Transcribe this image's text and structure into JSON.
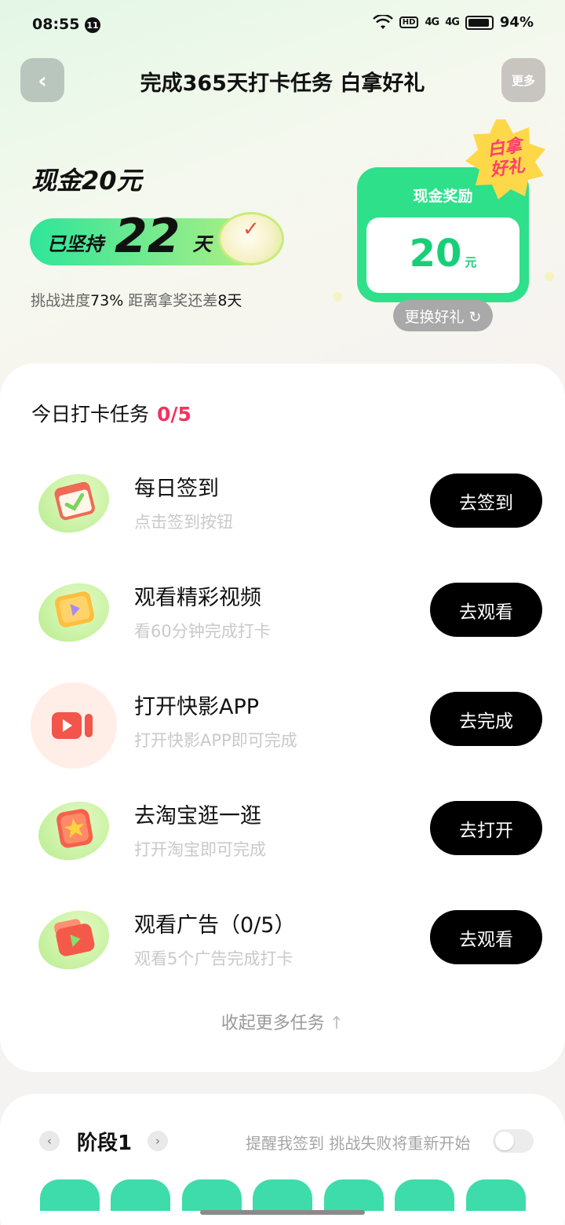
{
  "status_bar": {
    "time": "08:55",
    "notification_count": "11",
    "hd_label": "HD",
    "signal1": "4G",
    "signal2": "4G",
    "battery_percent": "94%",
    "battery_level": 0.94
  },
  "nav": {
    "back_icon": "‹",
    "title": "完成365天打卡任务 白拿好礼",
    "more_label": "更多"
  },
  "hero": {
    "cash_title": "现金20元",
    "streak_prefix": "已坚持",
    "streak_days": "22",
    "streak_suffix": "天",
    "progress_prefix": "挑战进度",
    "progress_percent": "73%",
    "progress_middle": "距离拿奖还差",
    "days_remaining": "8天"
  },
  "reward": {
    "label": "现金奖励",
    "amount": "20",
    "unit": "元",
    "badge_line1": "白拿",
    "badge_line2": "好礼",
    "swap_label": "更换好礼 ↻"
  },
  "tasks": {
    "header": "今日打卡任务",
    "count": "0/5",
    "items": [
      {
        "title": "每日签到",
        "subtitle": "点击签到按钮",
        "button": "去签到",
        "icon": "calendar-check-icon"
      },
      {
        "title": "观看精彩视频",
        "subtitle": "看60分钟完成打卡",
        "button": "去观看",
        "icon": "video-tablet-icon"
      },
      {
        "title": "打开快影APP",
        "subtitle": "打开快影APP即可完成",
        "button": "去完成",
        "icon": "video-camera-icon"
      },
      {
        "title": "去淘宝逛一逛",
        "subtitle": "打开淘宝即可完成",
        "button": "去打开",
        "icon": "star-shop-icon"
      },
      {
        "title": "观看广告（0/5）",
        "subtitle": "观看5个广告完成打卡",
        "button": "去观看",
        "icon": "ad-play-icon"
      }
    ],
    "collapse_label": "收起更多任务",
    "collapse_arrow": "↑"
  },
  "stage": {
    "prev_icon": "‹",
    "title": "阶段1",
    "next_icon": "›",
    "reminder": "提醒我签到 挑战失败将重新开始",
    "toggle_on": false
  },
  "colors": {
    "accent_green": "#2fe08a",
    "count_red": "#f1335f",
    "badge_yellow": "#ffd84a"
  }
}
